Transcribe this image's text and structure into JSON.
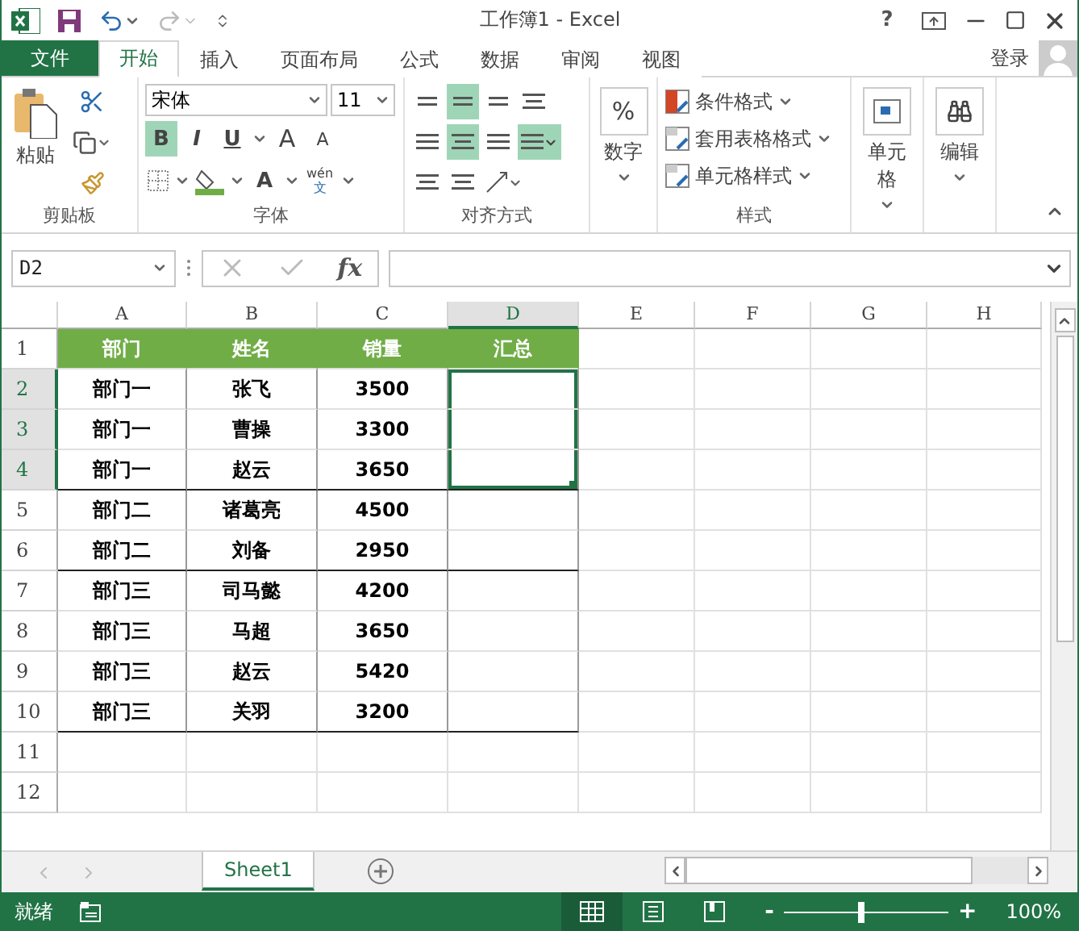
{
  "window": {
    "title": "工作簿1 - Excel",
    "help": "?"
  },
  "file_tab": "文件",
  "ribbon_tabs": [
    {
      "label": "开始",
      "selected": true
    },
    {
      "label": "插入",
      "selected": false
    },
    {
      "label": "页面布局",
      "selected": false
    },
    {
      "label": "公式",
      "selected": false
    },
    {
      "label": "数据",
      "selected": false
    },
    {
      "label": "审阅",
      "selected": false
    },
    {
      "label": "视图",
      "selected": false
    }
  ],
  "sign_in": "登录",
  "clipboard": {
    "label": "剪贴板",
    "paste": "粘贴"
  },
  "font": {
    "label": "字体",
    "name": "宋体",
    "size": "11",
    "styles": [
      {
        "label": "B",
        "selected": true
      },
      {
        "label": "I",
        "selected": false
      },
      {
        "label": "U",
        "selected": false
      }
    ],
    "grow": "A",
    "shrink": "A",
    "color_button": "A",
    "phonetic_top": "wén",
    "phonetic_bottom": "文"
  },
  "alignment": {
    "label": "对齐方式",
    "top_row": [
      {
        "selected": false
      },
      {
        "selected": true
      },
      {
        "selected": false
      }
    ],
    "middle_row": [
      {
        "selected": false
      },
      {
        "selected": true
      },
      {
        "selected": false
      }
    ],
    "wrap_selected": false,
    "merge_selected": true
  },
  "number": {
    "label": "数字",
    "symbol": "%"
  },
  "styles": {
    "label": "样式",
    "items": [
      "条件格式",
      "套用表格格式",
      "单元格样式"
    ]
  },
  "cells": {
    "label": "单元格"
  },
  "editing": {
    "label": "编辑"
  },
  "name_box": "D2",
  "function_button": "fx",
  "columns": [
    {
      "label": "A",
      "selected": false
    },
    {
      "label": "B",
      "selected": false
    },
    {
      "label": "C",
      "selected": false
    },
    {
      "label": "D",
      "selected": true
    },
    {
      "label": "E",
      "selected": false
    },
    {
      "label": "F",
      "selected": false
    },
    {
      "label": "G",
      "selected": false
    },
    {
      "label": "H",
      "selected": false
    }
  ],
  "rows": [
    {
      "number": "1",
      "selected": false,
      "kind": "header",
      "cells": [
        "部门",
        "姓名",
        "销量",
        "汇总"
      ]
    },
    {
      "number": "2",
      "selected": true,
      "kind": "data",
      "group_end": false,
      "cells": [
        "部门一",
        "张飞",
        "3500",
        ""
      ]
    },
    {
      "number": "3",
      "selected": true,
      "kind": "data",
      "group_end": false,
      "cells": [
        "部门一",
        "曹操",
        "3300",
        ""
      ]
    },
    {
      "number": "4",
      "selected": true,
      "kind": "data",
      "group_end": true,
      "cells": [
        "部门一",
        "赵云",
        "3650",
        ""
      ]
    },
    {
      "number": "5",
      "selected": false,
      "kind": "data",
      "group_end": false,
      "cells": [
        "部门二",
        "诸葛亮",
        "4500",
        ""
      ]
    },
    {
      "number": "6",
      "selected": false,
      "kind": "data",
      "group_end": true,
      "cells": [
        "部门二",
        "刘备",
        "2950",
        ""
      ]
    },
    {
      "number": "7",
      "selected": false,
      "kind": "data",
      "group_end": false,
      "cells": [
        "部门三",
        "司马懿",
        "4200",
        ""
      ]
    },
    {
      "number": "8",
      "selected": false,
      "kind": "data",
      "group_end": false,
      "cells": [
        "部门三",
        "马超",
        "3650",
        ""
      ]
    },
    {
      "number": "9",
      "selected": false,
      "kind": "data",
      "group_end": false,
      "cells": [
        "部门三",
        "赵云",
        "5420",
        ""
      ]
    },
    {
      "number": "10",
      "selected": false,
      "kind": "data",
      "group_end": true,
      "cells": [
        "部门三",
        "关羽",
        "3200",
        ""
      ]
    },
    {
      "number": "11",
      "selected": false,
      "kind": "empty",
      "cells": []
    },
    {
      "number": "12",
      "selected": false,
      "kind": "empty",
      "cells": []
    }
  ],
  "sheet_tabs": [
    {
      "label": "Sheet1",
      "selected": true
    }
  ],
  "status": {
    "text": "就绪",
    "views": [
      {
        "selected": true
      },
      {
        "selected": false
      },
      {
        "selected": false
      }
    ],
    "zoom_out": "-",
    "zoom_in": "+",
    "zoom": {
      "level": 0.47
    },
    "zoom_reading": "100%"
  }
}
